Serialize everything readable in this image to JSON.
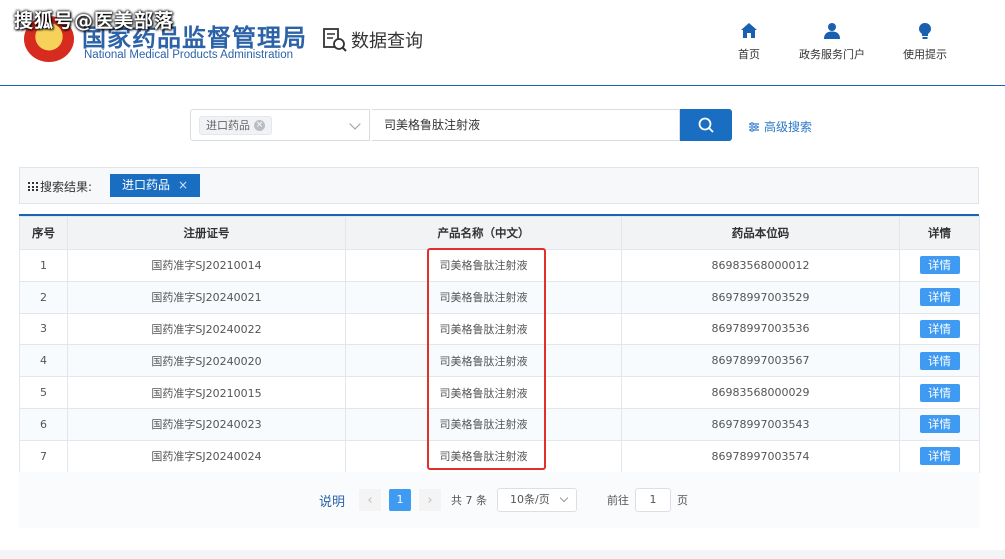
{
  "watermark": "搜狐号@医美部落",
  "header": {
    "logo_cn": "国家药品监督管理局",
    "logo_en": "National Medical Products Administration",
    "data_query": "数据查询",
    "nav": [
      {
        "label": "首页",
        "icon": "home-icon"
      },
      {
        "label": "政务服务门户",
        "icon": "user-icon"
      },
      {
        "label": "使用提示",
        "icon": "lightbulb-icon"
      }
    ]
  },
  "search": {
    "category_tag": "进口药品",
    "query": "司美格鲁肽注射液",
    "advanced": "高级搜索"
  },
  "results": {
    "label": "搜索结果:",
    "tag": "进口药品"
  },
  "table": {
    "headers": [
      "序号",
      "注册证号",
      "产品名称（中文）",
      "药品本位码",
      "详情"
    ],
    "detail_label": "详情",
    "rows": [
      {
        "no": "1",
        "reg": "国药准字SJ20210014",
        "name": "司美格鲁肽注射液",
        "code": "86983568000012"
      },
      {
        "no": "2",
        "reg": "国药准字SJ20240021",
        "name": "司美格鲁肽注射液",
        "code": "86978997003529"
      },
      {
        "no": "3",
        "reg": "国药准字SJ20240022",
        "name": "司美格鲁肽注射液",
        "code": "86978997003536"
      },
      {
        "no": "4",
        "reg": "国药准字SJ20240020",
        "name": "司美格鲁肽注射液",
        "code": "86978997003567"
      },
      {
        "no": "5",
        "reg": "国药准字SJ20210015",
        "name": "司美格鲁肽注射液",
        "code": "86983568000029"
      },
      {
        "no": "6",
        "reg": "国药准字SJ20240023",
        "name": "司美格鲁肽注射液",
        "code": "86978997003543"
      },
      {
        "no": "7",
        "reg": "国药准字SJ20240024",
        "name": "司美格鲁肽注射液",
        "code": "86978997003574"
      }
    ]
  },
  "pagination": {
    "explain": "说明",
    "current_page": "1",
    "total": "共 7 条",
    "page_size": "10条/页",
    "goto_label": "前往",
    "goto_value": "1",
    "page_unit": "页"
  },
  "colors": {
    "brand": "#1a64b6",
    "primary_button": "#1a6ec1",
    "detail_button": "#3f9af1",
    "highlight": "#e0302a"
  }
}
